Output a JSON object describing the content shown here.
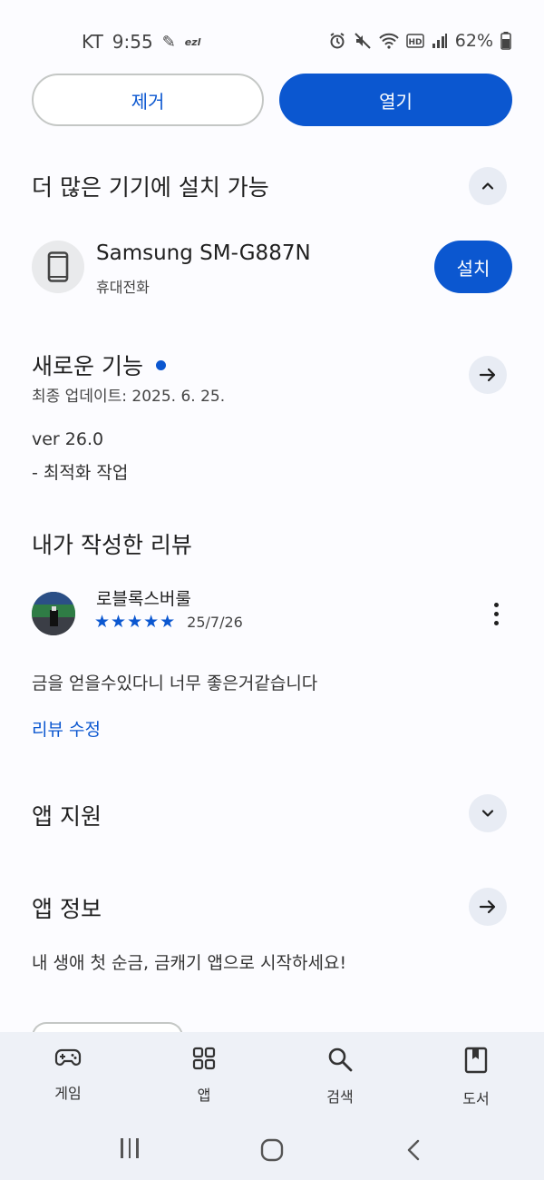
{
  "status_bar": {
    "carrier": "KT",
    "time": "9:55",
    "extra_label": "ezl",
    "battery": "62%",
    "icons": [
      "alarm-icon",
      "mute-icon",
      "wifi-icon",
      "hd-icon",
      "signal-icon",
      "battery-icon"
    ]
  },
  "actions": {
    "remove_label": "제거",
    "open_label": "열기"
  },
  "more_devices": {
    "title": "더 많은 기기에 설치 가능",
    "device_name": "Samsung SM-G887N",
    "device_type": "휴대전화",
    "install_label": "설치"
  },
  "whats_new": {
    "title": "새로운 기능",
    "updated": "최종 업데이트: 2025. 6. 25.",
    "version": "ver 26.0",
    "notes": "- 최적화 작업"
  },
  "my_review": {
    "title": "내가 작성한 리뷰",
    "author": "로블록스버룰",
    "rating": 5,
    "stars": "★★★★★",
    "date": "25/7/26",
    "text": "금을 얻을수있다니 너무 좋은거같습니다",
    "edit_label": "리뷰 수정"
  },
  "app_support": {
    "title": "앱 지원"
  },
  "app_info": {
    "title": "앱 정보",
    "description": "내 생애 첫 순금, 금캐기 앱으로 시작하세요!"
  },
  "bottom_nav": {
    "items": [
      {
        "label": "게임",
        "icon": "gamepad-icon"
      },
      {
        "label": "앱",
        "icon": "apps-grid-icon"
      },
      {
        "label": "검색",
        "icon": "search-icon"
      },
      {
        "label": "도서",
        "icon": "book-icon"
      }
    ]
  },
  "colors": {
    "accent": "#0b57d0",
    "background": "#fcfcff",
    "nav_background": "#eef1f7"
  }
}
